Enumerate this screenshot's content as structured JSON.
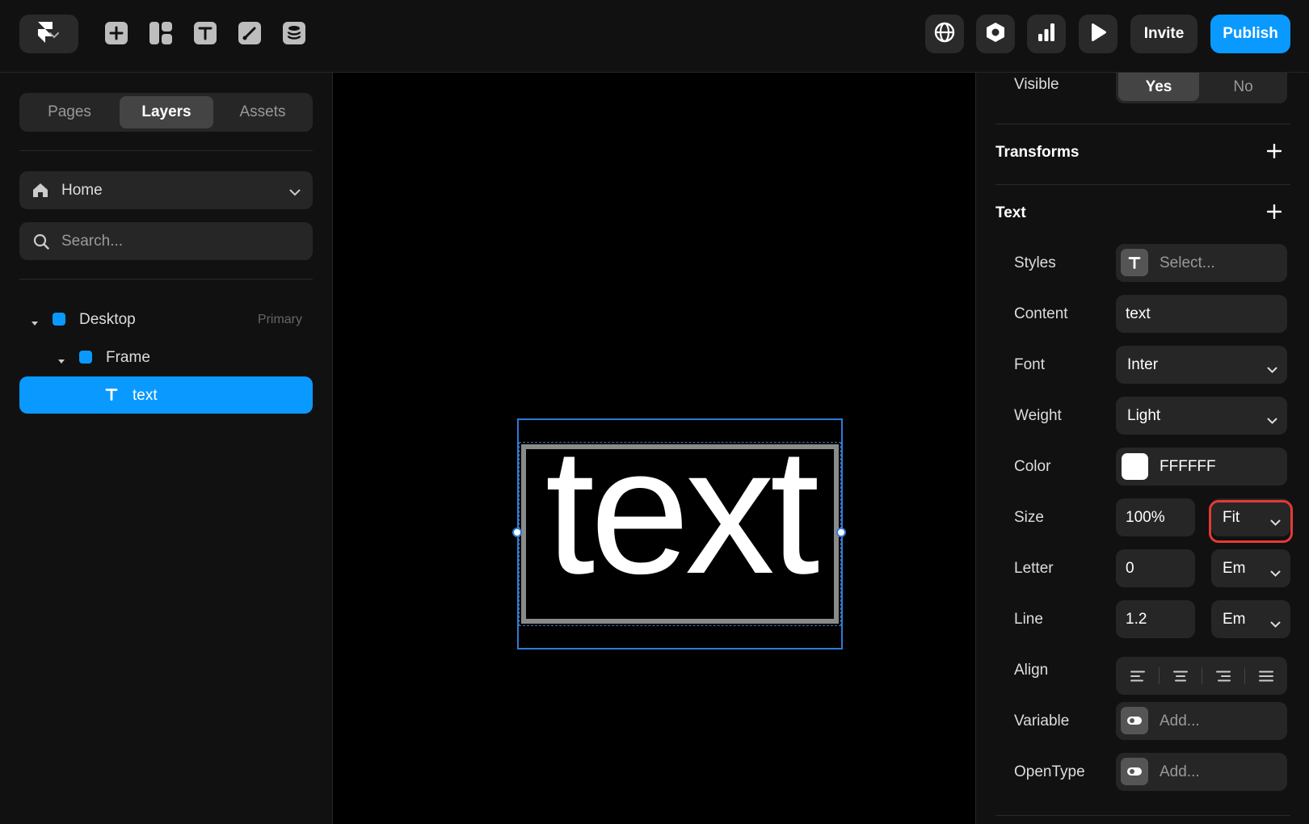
{
  "toolbar": {
    "invite_label": "Invite",
    "publish_label": "Publish",
    "publish_color": "#0a99ff",
    "tool_icons": [
      "plus-icon",
      "layout-icon",
      "text-tool-icon",
      "pen-icon",
      "database-icon"
    ],
    "right_icons": [
      "globe-icon",
      "settings-hexagon-icon",
      "analytics-icon",
      "play-icon"
    ]
  },
  "left": {
    "tabs": [
      {
        "label": "Pages",
        "active": false
      },
      {
        "label": "Layers",
        "active": true
      },
      {
        "label": "Assets",
        "active": false
      }
    ],
    "page_select": "Home",
    "search_placeholder": "Search...",
    "layers": [
      {
        "name": "Desktop",
        "tag": "Primary",
        "type": "frame",
        "expanded": true
      },
      {
        "name": "Frame",
        "type": "frame",
        "expanded": true
      },
      {
        "name": "text",
        "type": "text",
        "selected": true
      }
    ]
  },
  "canvas": {
    "text": "text"
  },
  "right": {
    "visible": {
      "label": "Visible",
      "yes": "Yes",
      "no": "No",
      "value": "Yes"
    },
    "transforms_title": "Transforms",
    "text_title": "Text",
    "props": {
      "styles": {
        "label": "Styles",
        "placeholder": "Select..."
      },
      "content": {
        "label": "Content",
        "value": "text"
      },
      "font": {
        "label": "Font",
        "value": "Inter"
      },
      "weight": {
        "label": "Weight",
        "value": "Light"
      },
      "color": {
        "label": "Color",
        "value": "FFFFFF",
        "swatch": "#FFFFFF"
      },
      "size": {
        "label": "Size",
        "value": "100%",
        "mode": "Fit"
      },
      "letter": {
        "label": "Letter",
        "value": "0",
        "unit": "Em"
      },
      "line": {
        "label": "Line",
        "value": "1.2",
        "unit": "Em"
      },
      "align": {
        "label": "Align",
        "options": [
          "left",
          "center",
          "right",
          "justify"
        ]
      },
      "variable": {
        "label": "Variable",
        "placeholder": "Add..."
      },
      "opentype": {
        "label": "OpenType",
        "placeholder": "Add..."
      }
    },
    "highlight_color": "#e53935"
  }
}
